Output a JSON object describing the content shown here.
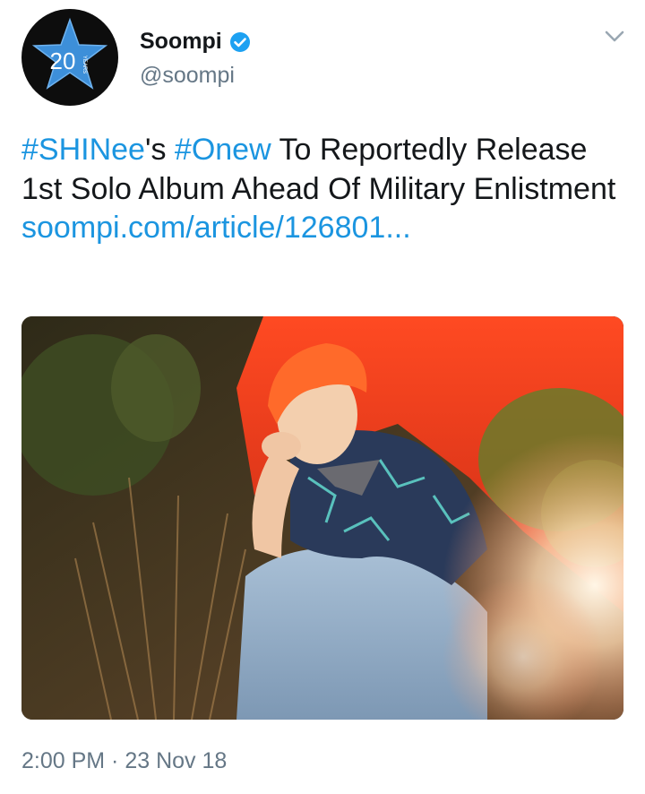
{
  "author": {
    "name": "Soompi",
    "handle": "@soompi",
    "avatar_text": "20",
    "avatar_subtext": "YEARS",
    "verified": true
  },
  "tweet": {
    "hashtag1": "#SHINee",
    "text1": "'s ",
    "hashtag2": "#Onew",
    "text2": " To Reportedly Release 1st Solo Album Ahead Of Military Enlistment",
    "link": "soompi.com/article/126801..."
  },
  "media": {
    "description_icon": "photo"
  },
  "timestamp": "2:00 PM · 23 Nov 18",
  "colors": {
    "link": "#1b95e0",
    "text": "#14171a",
    "muted": "#657786",
    "star": "#3d8fd9"
  }
}
